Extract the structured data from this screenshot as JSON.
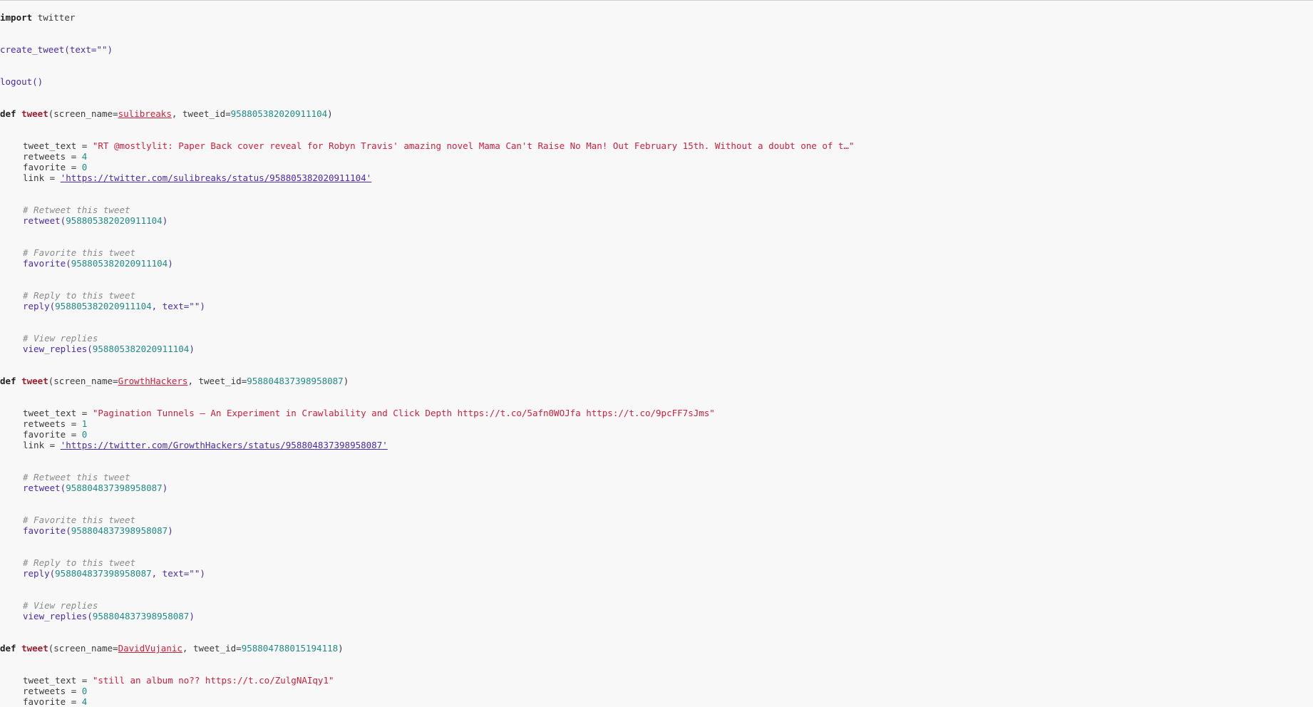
{
  "code": {
    "import_kw": "import",
    "import_mod": "twitter",
    "create_tweet_call": "create_tweet(text=\"\")",
    "logout_call": "logout()",
    "def_kw": "def",
    "tweet_fn": "tweet",
    "screen_name_arg": "(screen_name=",
    "tweet_id_arg": ", tweet_id=",
    "close_paren": ")",
    "tweet_text_label": "tweet_text = ",
    "retweets_label": "retweets = ",
    "favorite_label": "favorite = ",
    "link_label": "link = ",
    "retweet_comment": "# Retweet this tweet",
    "favorite_comment": "# Favorite this tweet",
    "reply_comment": "# Reply to this tweet",
    "view_replies_comment": "# View replies",
    "retweet_fn": "retweet(",
    "favorite_fn": "favorite(",
    "reply_fn": "reply(",
    "reply_text_arg": ", text=\"\")",
    "view_replies_fn": "view_replies("
  },
  "tweets": [
    {
      "screen_name": "sulibreaks",
      "tweet_id": "958805382020911104",
      "tweet_text": "\"RT @mostlylit: Paper Back cover reveal for Robyn Travis' amazing novel Mama Can't Raise No Man! Out February 15th. Without a doubt one of t…\"",
      "retweets": "4",
      "favorite": "0",
      "link": "'https://twitter.com/sulibreaks/status/958805382020911104'"
    },
    {
      "screen_name": "GrowthHackers",
      "tweet_id": "958804837398958087",
      "tweet_text": "\"Pagination Tunnels – An Experiment in Crawlability and Click Depth https://t.co/5afn0WOJfa https://t.co/9pcFF7sJms\"",
      "retweets": "1",
      "favorite": "0",
      "link": "'https://twitter.com/GrowthHackers/status/958804837398958087'"
    },
    {
      "screen_name": "DavidVujanic",
      "tweet_id": "958804788015194118",
      "tweet_text": "\"still an album no?? https://t.co/ZulgNAIqy1\"",
      "retweets": "0",
      "favorite": "4"
    }
  ]
}
